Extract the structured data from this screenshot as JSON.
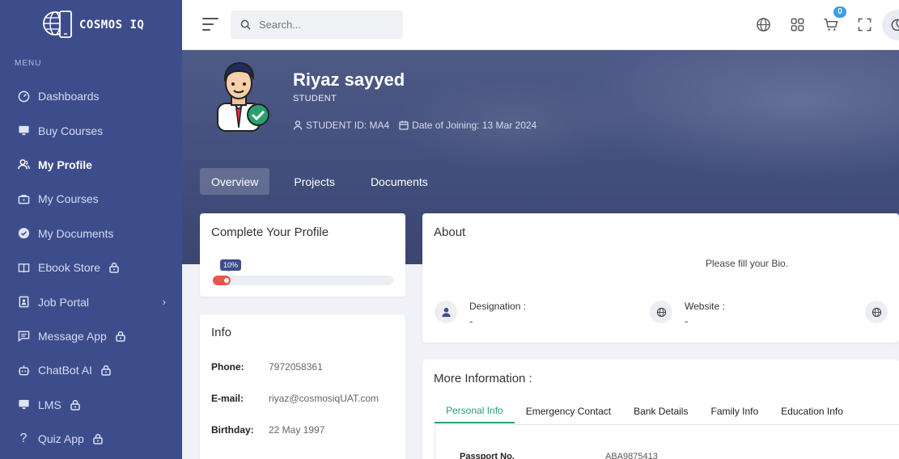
{
  "brand": {
    "name": "COSMOS IQ"
  },
  "sidebar": {
    "menu_label": "MENU",
    "items": [
      {
        "label": "Dashboards",
        "icon": "dashboard-icon",
        "locked": false
      },
      {
        "label": "Buy Courses",
        "icon": "monitor-icon",
        "locked": false
      },
      {
        "label": "My Profile",
        "icon": "user-icon",
        "locked": false,
        "active": true
      },
      {
        "label": "My Courses",
        "icon": "briefcase-icon",
        "locked": false
      },
      {
        "label": "My Documents",
        "icon": "check-circle-icon",
        "locked": false
      },
      {
        "label": "Ebook Store",
        "icon": "book-icon",
        "locked": true
      },
      {
        "label": "Job Portal",
        "icon": "job-icon",
        "locked": false,
        "submenu": true
      },
      {
        "label": "Message App",
        "icon": "message-icon",
        "locked": true
      },
      {
        "label": "ChatBot AI",
        "icon": "bot-icon",
        "locked": true
      },
      {
        "label": "LMS",
        "icon": "monitor-icon",
        "locked": true
      },
      {
        "label": "Quiz App",
        "icon": "question-icon",
        "locked": true
      }
    ]
  },
  "topbar": {
    "search_placeholder": "Search...",
    "cart_count": "0"
  },
  "profile": {
    "name": "Riyaz sayyed",
    "role": "STUDENT",
    "student_id": "STUDENT ID: MA4",
    "joining": "Date of Joining: 13 Mar 2024",
    "tabs": [
      "Overview",
      "Projects",
      "Documents"
    ]
  },
  "complete_profile": {
    "title": "Complete Your Profile",
    "percent_label": "10%",
    "percent": 10
  },
  "info": {
    "title": "Info",
    "rows": [
      {
        "key": "Phone:",
        "value": "7972058361"
      },
      {
        "key": "E-mail:",
        "value": "riyaz@cosmosiqUAT.com"
      },
      {
        "key": "Birthday:",
        "value": "22 May 1997"
      }
    ]
  },
  "about": {
    "title": "About",
    "bio": "Please fill your Bio.",
    "designation_label": "Designation :",
    "designation_value": "-",
    "website_label": "Website :",
    "website_value": "-"
  },
  "more_info": {
    "title": "More Information :",
    "tabs": [
      "Personal Info",
      "Emergency Contact",
      "Bank Details",
      "Family Info",
      "Education Info"
    ],
    "passport_label": "Passport No.",
    "passport_value": "ABA9875413"
  },
  "colors": {
    "sidebar_bg": "#3d4d8c",
    "accent_green": "#2aa06f",
    "progress": "#e8574b",
    "badge": "#3aa0e3"
  }
}
